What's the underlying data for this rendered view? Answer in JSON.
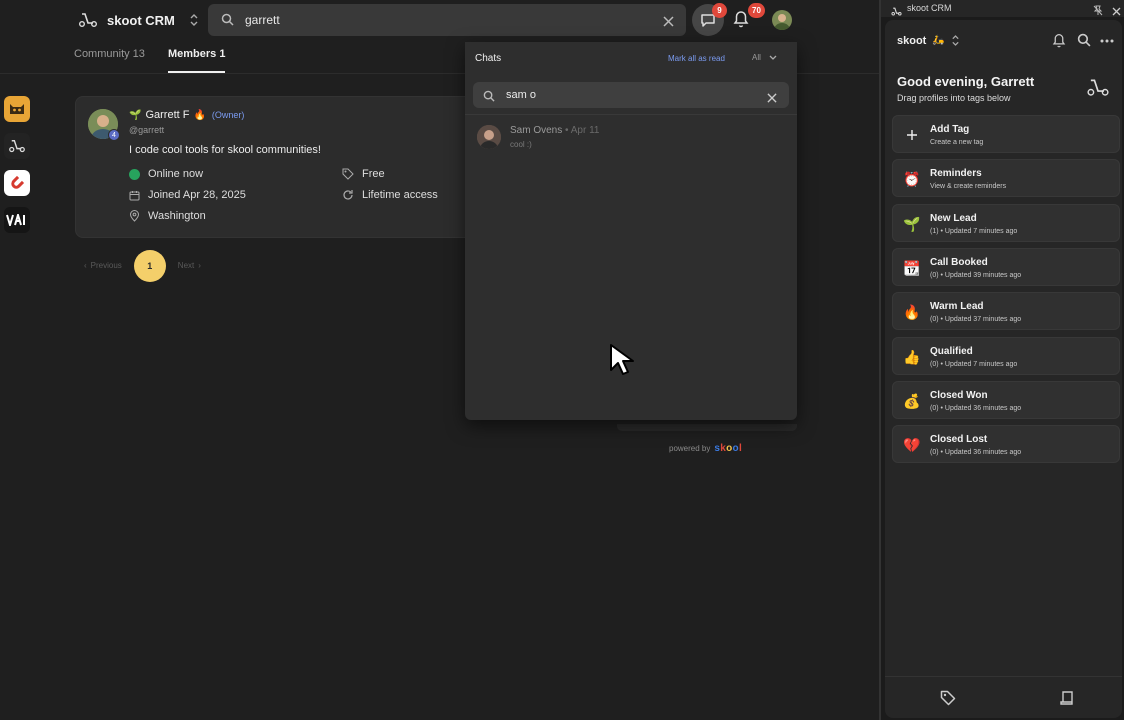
{
  "header": {
    "brand": "skoot CRM",
    "search_value": "garrett",
    "chat_badge": "9",
    "notif_badge": "70"
  },
  "tabs": [
    {
      "label": "Community 13"
    },
    {
      "label": "Members 1"
    }
  ],
  "member": {
    "name": "Garrett F",
    "owner_label": "(Owner)",
    "handle": "@garrett",
    "level": "4",
    "bio": "I code cool tools for skool communities!",
    "status": "Online now",
    "joined": "Joined Apr 28, 2025",
    "location": "Washington",
    "price": "Free",
    "access": "Lifetime access"
  },
  "pagination": {
    "prev": "Previous",
    "page": "1",
    "next": "Next"
  },
  "chats": {
    "title": "Chats",
    "mark_all": "Mark all as read",
    "filter": "All",
    "search_value": "sam o",
    "items": [
      {
        "name": "Sam Ovens",
        "date": "Apr 11",
        "message": "cool :)"
      }
    ]
  },
  "footer": {
    "powered_by": "powered by",
    "brand": "skool"
  },
  "panel": {
    "window_title": "skoot CRM",
    "workspace": "skoot",
    "workspace_emoji": "🛵",
    "greeting": "Good evening, Garrett",
    "subtitle": "Drag profiles into tags below",
    "tags": [
      {
        "icon": "plus-icon",
        "emoji": "",
        "name": "Add Tag",
        "sub": "Create a new tag"
      },
      {
        "icon": "alarm-clock-icon",
        "emoji": "⏰",
        "name": "Reminders",
        "sub": "View & create reminders"
      },
      {
        "icon": "seedling-icon",
        "emoji": "🌱",
        "name": "New Lead",
        "sub": "(1)  • Updated 7 minutes ago"
      },
      {
        "icon": "calendar-icon",
        "emoji": "📆",
        "name": "Call Booked",
        "sub": "(0)  • Updated 39 minutes ago"
      },
      {
        "icon": "fire-icon",
        "emoji": "🔥",
        "name": "Warm Lead",
        "sub": "(0)  • Updated 37 minutes ago"
      },
      {
        "icon": "thumbs-up-icon",
        "emoji": "👍",
        "name": "Qualified",
        "sub": "(0)  • Updated 7 minutes ago"
      },
      {
        "icon": "money-bag-icon",
        "emoji": "💰",
        "name": "Closed Won",
        "sub": "(0)  • Updated 36 minutes ago"
      },
      {
        "icon": "broken-heart-icon",
        "emoji": "💔",
        "name": "Closed Lost",
        "sub": "(0)  • Updated 36 minutes ago"
      }
    ]
  },
  "colors": {
    "accent": "#f4cf6a",
    "badge": "#e0483b",
    "link": "#7b9bf0",
    "online": "#27a35d"
  }
}
